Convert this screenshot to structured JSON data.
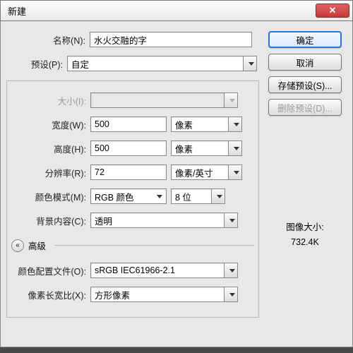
{
  "window": {
    "title": "新建"
  },
  "fields": {
    "name": {
      "label": "名称(N):",
      "value": "水火交融的字"
    },
    "preset": {
      "label": "预设(P):",
      "value": "自定"
    },
    "size": {
      "label": "大小(I):",
      "value": ""
    },
    "width": {
      "label": "宽度(W):",
      "value": "500",
      "unit": "像素"
    },
    "height": {
      "label": "高度(H):",
      "value": "500",
      "unit": "像素"
    },
    "resolution": {
      "label": "分辨率(R):",
      "value": "72",
      "unit": "像素/英寸"
    },
    "colormode": {
      "label": "颜色模式(M):",
      "value": "RGB 颜色",
      "depth": "8 位"
    },
    "background": {
      "label": "背景内容(C):",
      "value": "透明"
    },
    "profile": {
      "label": "颜色配置文件(O):",
      "value": "sRGB IEC61966-2.1"
    },
    "aspect": {
      "label": "像素长宽比(X):",
      "value": "方形像素"
    }
  },
  "advanced": {
    "label": "高级",
    "toggle": "«"
  },
  "buttons": {
    "ok": "确定",
    "cancel": "取消",
    "savePreset": "存储预设(S)...",
    "deletePreset": "删除预设(D)..."
  },
  "imageSize": {
    "label": "图像大小:",
    "value": "732.4K"
  }
}
